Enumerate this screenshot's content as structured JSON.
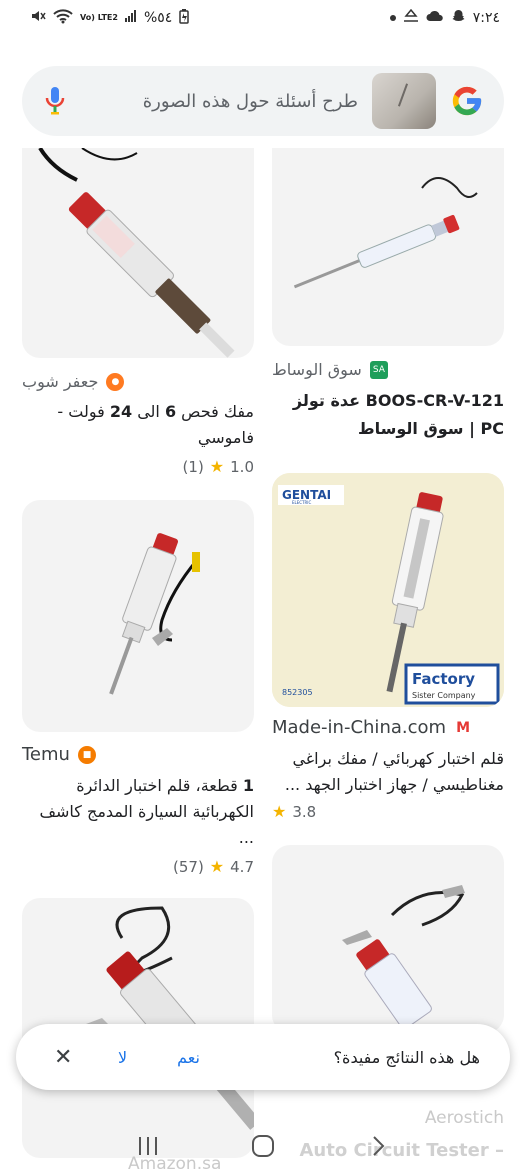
{
  "status_bar": {
    "time": "٧:٢٤",
    "battery": "%٥٤",
    "network": "Vo) LTE2"
  },
  "search": {
    "placeholder": "طرح أسئلة حول هذه الصورة"
  },
  "results": [
    {
      "source": "جعفر شوب",
      "favicon_color": "#ff7a21",
      "title_parts": [
        "مفك فحص ",
        "6",
        " الى ",
        "24",
        " فولت - فاموسي"
      ],
      "rating": "1.0",
      "reviews": "(1)"
    },
    {
      "source": "سوق الوساط",
      "favicon_color": "#1e9e5a",
      "title": "BOOS-CR-V-121 عدة تولز PC | سوق الوساط"
    },
    {
      "source": "Temu",
      "favicon_color": "#f57c00",
      "title_parts": [
        "1",
        " قطعة، قلم اختبار الدائرة الكهربائية السيارة المدمج كاشف ..."
      ],
      "rating": "4.7",
      "reviews": "(57)"
    },
    {
      "source": "Made-in-China.com",
      "favicon_color": "#e53935",
      "title": "قلم اختبار كهربائي / مفك براغي مغناطيسي / جهاز اختبار الجهد ...",
      "rating": "3.8",
      "image_labels": {
        "brand": "GENTAI",
        "brand_sub": "ELECTRIC",
        "factory": "Factory",
        "factory_sub": "Sister Company",
        "code": "852305"
      }
    },
    {
      "source": "Aerostich",
      "title": "Auto Circuit Tester –"
    },
    {
      "source": "Amazon.sa"
    }
  ],
  "feedback": {
    "question": "هل هذه النتائج مفيدة؟",
    "yes": "نعم",
    "no": "لا",
    "close": "✕"
  },
  "nav": {
    "recents": "|||",
    "home": "◯",
    "back": "›"
  }
}
